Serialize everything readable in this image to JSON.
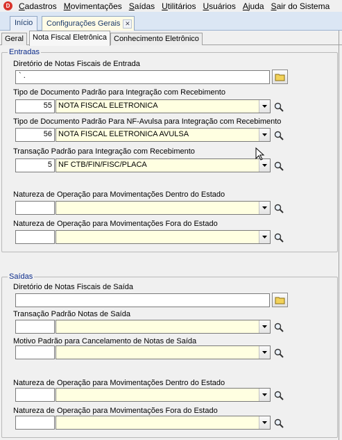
{
  "menu": {
    "items": [
      "Cadastros",
      "Movimentações",
      "Saídas",
      "Utilitários",
      "Usuários",
      "Ajuda",
      "Sair do Sistema"
    ]
  },
  "doc_tabs": [
    "Início",
    "Configurações Gerais"
  ],
  "sub_tabs": [
    "Geral",
    "Nota Fiscal Eletrônica",
    "Conhecimento Eletrônico"
  ],
  "entradas": {
    "legend": "Entradas",
    "dir_label": "Diretório de Notas Fiscais de Entrada",
    "dir_value": "`                .",
    "tipo_doc": {
      "label": "Tipo de Documento Padrão para Integração com Recebimento",
      "code": "55",
      "value": "NOTA FISCAL ELETRONICA"
    },
    "tipo_doc_avulsa": {
      "label": "Tipo de Documento Padrão Para NF-Avulsa para Integração com Recebimento",
      "code": "56",
      "value": "NOTA FISCAL ELETRONICA AVULSA"
    },
    "transacao": {
      "label": "Transação Padrão para Integração com Recebimento",
      "code": "5",
      "value": "NF CTB/FIN/FISC/PLACA"
    },
    "nat_dentro": {
      "label": "Natureza de Operação para Movimentações Dentro do Estado",
      "code": "",
      "value": ""
    },
    "nat_fora": {
      "label": "Natureza de Operação para Movimentações Fora do Estado",
      "code": "",
      "value": ""
    }
  },
  "saidas": {
    "legend": "Saídas",
    "dir_label": "Diretório de Notas Fiscais de Saída",
    "dir_value": "",
    "transacao": {
      "label": "Transação Padrão  Notas de Saída",
      "code": "",
      "value": ""
    },
    "motivo": {
      "label": "Motivo Padrão para Cancelamento de Notas de Saída",
      "code": "",
      "value": ""
    },
    "nat_dentro": {
      "label": "Natureza de Operação para Movimentações Dentro do Estado",
      "code": "",
      "value": ""
    },
    "nat_fora": {
      "label": "Natureza de Operação para Movimentações Fora do Estado",
      "code": "",
      "value": ""
    }
  },
  "icons": {
    "app": "app-logo-icon",
    "folder": "folder-icon",
    "lookup": "magnifier-icon",
    "dropdown": "chevron-down-icon",
    "close": "close-icon"
  },
  "colors": {
    "combo_bg": "#ffffe1",
    "legend_text": "#0a2a8a",
    "tab_bar": "#dbe6f4"
  }
}
